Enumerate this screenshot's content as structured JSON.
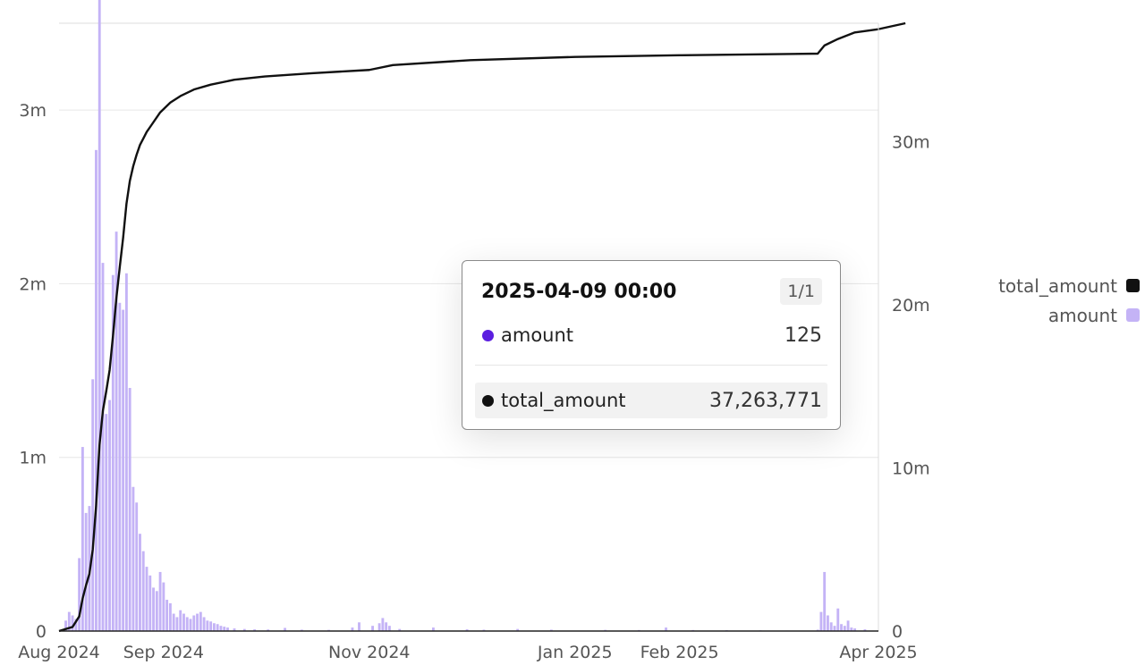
{
  "chart_data": {
    "type": "bar+line",
    "title": "",
    "x_axis": {
      "type": "time",
      "range": [
        "2024-08-01",
        "2025-04-01"
      ],
      "tick_labels": [
        "Aug 2024",
        "Sep 2024",
        "Nov 2024",
        "Jan 2025",
        "Feb 2025",
        "Apr 2025"
      ],
      "tick_dates": [
        "2024-08-01",
        "2024-09-01",
        "2024-11-01",
        "2025-01-01",
        "2025-02-01",
        "2025-04-01"
      ]
    },
    "y_axis_left": {
      "range": [
        0,
        3500000
      ],
      "ticks": [
        0,
        1000000,
        2000000,
        3000000
      ],
      "tick_labels": [
        "0",
        "1m",
        "2m",
        "3m"
      ]
    },
    "y_axis_right": {
      "range": [
        0,
        37263771
      ],
      "ticks": [
        0,
        10000000,
        20000000,
        30000000
      ],
      "tick_labels": [
        "0",
        "10m",
        "20m",
        "30m"
      ]
    },
    "grid": "horizontal",
    "legend_position": "right",
    "series": [
      {
        "name": "amount",
        "type": "bar",
        "axis": "left",
        "color": "#c4b3f6",
        "points": [
          [
            "2024-08-03",
            60000
          ],
          [
            "2024-08-04",
            110000
          ],
          [
            "2024-08-05",
            90000
          ],
          [
            "2024-08-06",
            70000
          ],
          [
            "2024-08-07",
            420000
          ],
          [
            "2024-08-08",
            1060000
          ],
          [
            "2024-08-09",
            680000
          ],
          [
            "2024-08-10",
            720000
          ],
          [
            "2024-08-11",
            1450000
          ],
          [
            "2024-08-12",
            2770000
          ],
          [
            "2024-08-13",
            3650000
          ],
          [
            "2024-08-14",
            2120000
          ],
          [
            "2024-08-15",
            1250000
          ],
          [
            "2024-08-16",
            1330000
          ],
          [
            "2024-08-17",
            2050000
          ],
          [
            "2024-08-18",
            2300000
          ],
          [
            "2024-08-19",
            1890000
          ],
          [
            "2024-08-20",
            1850000
          ],
          [
            "2024-08-21",
            2060000
          ],
          [
            "2024-08-22",
            1400000
          ],
          [
            "2024-08-23",
            830000
          ],
          [
            "2024-08-24",
            740000
          ],
          [
            "2024-08-25",
            560000
          ],
          [
            "2024-08-26",
            460000
          ],
          [
            "2024-08-27",
            370000
          ],
          [
            "2024-08-28",
            320000
          ],
          [
            "2024-08-29",
            250000
          ],
          [
            "2024-08-30",
            230000
          ],
          [
            "2024-08-31",
            340000
          ],
          [
            "2024-09-01",
            280000
          ],
          [
            "2024-09-02",
            180000
          ],
          [
            "2024-09-03",
            160000
          ],
          [
            "2024-09-04",
            100000
          ],
          [
            "2024-09-05",
            80000
          ],
          [
            "2024-09-06",
            120000
          ],
          [
            "2024-09-07",
            100000
          ],
          [
            "2024-09-08",
            80000
          ],
          [
            "2024-09-09",
            70000
          ],
          [
            "2024-09-10",
            90000
          ],
          [
            "2024-09-11",
            100000
          ],
          [
            "2024-09-12",
            110000
          ],
          [
            "2024-09-13",
            80000
          ],
          [
            "2024-09-14",
            60000
          ],
          [
            "2024-09-15",
            55000
          ],
          [
            "2024-09-16",
            45000
          ],
          [
            "2024-09-17",
            40000
          ],
          [
            "2024-09-18",
            30000
          ],
          [
            "2024-09-19",
            25000
          ],
          [
            "2024-09-20",
            20000
          ],
          [
            "2024-09-22",
            15000
          ],
          [
            "2024-09-25",
            12000
          ],
          [
            "2024-09-28",
            10000
          ],
          [
            "2024-10-02",
            9000
          ],
          [
            "2024-10-07",
            18000
          ],
          [
            "2024-10-12",
            8000
          ],
          [
            "2024-10-20",
            7000
          ],
          [
            "2024-10-27",
            20000
          ],
          [
            "2024-10-29",
            50000
          ],
          [
            "2024-11-02",
            30000
          ],
          [
            "2024-11-04",
            45000
          ],
          [
            "2024-11-05",
            75000
          ],
          [
            "2024-11-06",
            50000
          ],
          [
            "2024-11-07",
            30000
          ],
          [
            "2024-11-10",
            12000
          ],
          [
            "2024-11-20",
            20000
          ],
          [
            "2024-11-30",
            10000
          ],
          [
            "2024-12-05",
            8000
          ],
          [
            "2024-12-15",
            12000
          ],
          [
            "2024-12-25",
            8000
          ],
          [
            "2025-01-10",
            7000
          ],
          [
            "2025-01-20",
            6000
          ],
          [
            "2025-01-28",
            20000
          ],
          [
            "2025-02-05",
            6000
          ],
          [
            "2025-02-15",
            5000
          ],
          [
            "2025-02-25",
            4000
          ],
          [
            "2025-03-05",
            3000
          ],
          [
            "2025-03-14",
            8000
          ],
          [
            "2025-03-15",
            110000
          ],
          [
            "2025-03-16",
            340000
          ],
          [
            "2025-03-17",
            90000
          ],
          [
            "2025-03-18",
            50000
          ],
          [
            "2025-03-19",
            30000
          ],
          [
            "2025-03-20",
            130000
          ],
          [
            "2025-03-21",
            40000
          ],
          [
            "2025-03-22",
            30000
          ],
          [
            "2025-03-23",
            60000
          ],
          [
            "2025-03-24",
            20000
          ],
          [
            "2025-03-25",
            15000
          ],
          [
            "2025-03-28",
            10000
          ],
          [
            "2025-04-09",
            125
          ]
        ]
      },
      {
        "name": "total_amount",
        "type": "line",
        "axis": "right",
        "color": "#111111",
        "points": [
          [
            "2024-08-01",
            0
          ],
          [
            "2024-08-05",
            250000
          ],
          [
            "2024-08-07",
            900000
          ],
          [
            "2024-08-08",
            2000000
          ],
          [
            "2024-08-09",
            2800000
          ],
          [
            "2024-08-10",
            3500000
          ],
          [
            "2024-08-11",
            5000000
          ],
          [
            "2024-08-12",
            7700000
          ],
          [
            "2024-08-13",
            11400000
          ],
          [
            "2024-08-14",
            13500000
          ],
          [
            "2024-08-15",
            14700000
          ],
          [
            "2024-08-16",
            16000000
          ],
          [
            "2024-08-17",
            18100000
          ],
          [
            "2024-08-18",
            20400000
          ],
          [
            "2024-08-19",
            22300000
          ],
          [
            "2024-08-20",
            24100000
          ],
          [
            "2024-08-21",
            26200000
          ],
          [
            "2024-08-22",
            27600000
          ],
          [
            "2024-08-23",
            28500000
          ],
          [
            "2024-08-24",
            29200000
          ],
          [
            "2024-08-25",
            29800000
          ],
          [
            "2024-08-26",
            30200000
          ],
          [
            "2024-08-27",
            30600000
          ],
          [
            "2024-08-28",
            30900000
          ],
          [
            "2024-08-31",
            31800000
          ],
          [
            "2024-09-03",
            32400000
          ],
          [
            "2024-09-06",
            32800000
          ],
          [
            "2024-09-10",
            33200000
          ],
          [
            "2024-09-15",
            33500000
          ],
          [
            "2024-09-22",
            33800000
          ],
          [
            "2024-10-01",
            34000000
          ],
          [
            "2024-10-15",
            34200000
          ],
          [
            "2024-11-01",
            34400000
          ],
          [
            "2024-11-08",
            34700000
          ],
          [
            "2024-12-01",
            35000000
          ],
          [
            "2025-01-01",
            35200000
          ],
          [
            "2025-02-01",
            35300000
          ],
          [
            "2025-03-14",
            35400000
          ],
          [
            "2025-03-16",
            35900000
          ],
          [
            "2025-03-20",
            36300000
          ],
          [
            "2025-03-25",
            36700000
          ],
          [
            "2025-04-01",
            36900000
          ],
          [
            "2025-04-09",
            37263771
          ]
        ]
      }
    ]
  },
  "legend": [
    {
      "label": "total_amount",
      "color": "#111111"
    },
    {
      "label": "amount",
      "color": "#c4b3f6"
    }
  ],
  "tooltip": {
    "header": "2025-04-09 00:00",
    "count": "1/1",
    "rows": [
      {
        "label": "amount",
        "value": "125",
        "dot_color": "#5b1ee0"
      },
      {
        "label": "total_amount",
        "value": "37,263,771",
        "dot_color": "#111111"
      }
    ]
  }
}
